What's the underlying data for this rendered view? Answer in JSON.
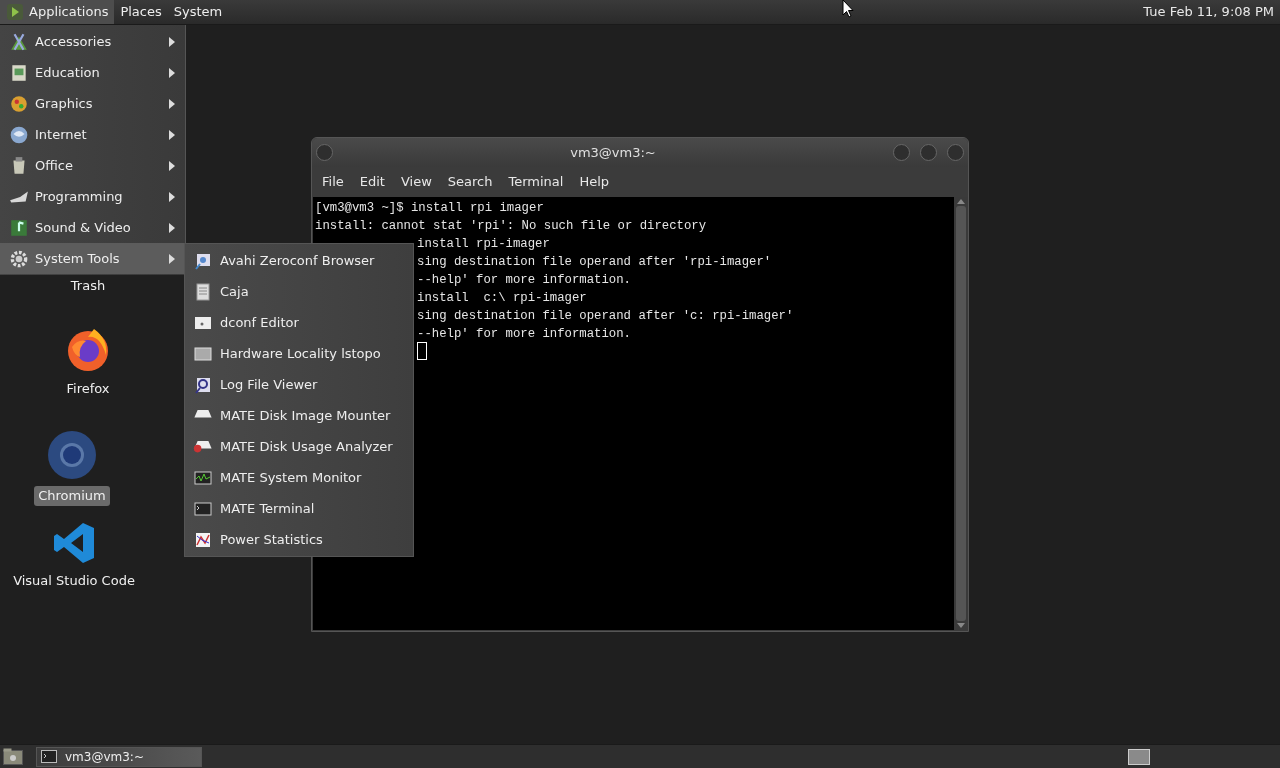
{
  "top_panel": {
    "menus": [
      {
        "label": "Applications",
        "selected": true
      },
      {
        "label": "Places",
        "selected": false
      },
      {
        "label": "System",
        "selected": false
      }
    ],
    "clock": "Tue Feb 11, 9:08 PM"
  },
  "applications_menu": {
    "items": [
      {
        "label": "Accessories",
        "selected": false
      },
      {
        "label": "Education",
        "selected": false
      },
      {
        "label": "Graphics",
        "selected": false
      },
      {
        "label": "Internet",
        "selected": false
      },
      {
        "label": "Office",
        "selected": false
      },
      {
        "label": "Programming",
        "selected": false
      },
      {
        "label": "Sound & Video",
        "selected": false
      },
      {
        "label": "System Tools",
        "selected": true
      }
    ]
  },
  "submenu": {
    "items": [
      "Avahi Zeroconf Browser",
      "Caja",
      "dconf Editor",
      "Hardware Locality lstopo",
      "Log File Viewer",
      "MATE Disk Image Mounter",
      "MATE Disk Usage Analyzer",
      "MATE System Monitor",
      "MATE Terminal",
      "Power Statistics"
    ]
  },
  "desktop_icons": [
    {
      "label": "Trash",
      "selected": false
    },
    {
      "label": "Firefox",
      "selected": false
    },
    {
      "label": "Chromium",
      "selected": true
    },
    {
      "label": "Visual Studio Code",
      "selected": false
    }
  ],
  "terminal": {
    "title": "vm3@vm3:~",
    "menu": [
      "File",
      "Edit",
      "View",
      "Search",
      "Terminal",
      "Help"
    ],
    "lines": [
      {
        "text": "[vm3@vm3 ~]$ install rpi imager"
      },
      {
        "text": "install: cannot stat 'rpi': No such file or directory"
      },
      {
        "text": "install rpi-imager",
        "clipped": true
      },
      {
        "text": "sing destination file operand after 'rpi-imager'",
        "clipped": true
      },
      {
        "text": "--help' for more information.",
        "clipped": true
      },
      {
        "text": "install  c:\\ rpi-imager",
        "clipped": true
      },
      {
        "text": "sing destination file operand after 'c: rpi-imager'",
        "clipped": true
      },
      {
        "text": "--help' for more information.",
        "clipped": true
      }
    ]
  },
  "taskbar": {
    "tasks": [
      "vm3@vm3:~"
    ]
  }
}
